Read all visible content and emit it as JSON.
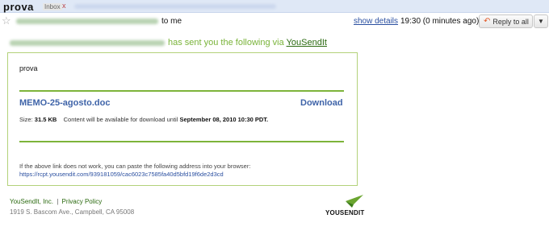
{
  "header": {
    "subject": "prova",
    "label": "Inbox",
    "label_remove": "x"
  },
  "sender_row": {
    "to_text": "to me",
    "show_details": "show details",
    "time": "19:30 (0 minutes ago)",
    "reply_button": "Reply to all",
    "more_button": "▼"
  },
  "intro": {
    "text": "has sent you the following via ",
    "link": "YouSendIt"
  },
  "card": {
    "message": "prova",
    "file_name": "MEMO-25-agosto.doc",
    "download": "Download",
    "size_label": "Size:",
    "size_value": "31.5 KB",
    "availability_text": "Content will be available for download until",
    "availability_date": "September 08, 2010 10:30 PDT.",
    "fallback_text": "If the above link does not work, you can paste the following address into your browser:",
    "fallback_url": "https://rcpt.yousendit.com/939181059/cac6023c7585fa40d5bfd19f6de2d3cd"
  },
  "footer": {
    "company": "YouSendIt, Inc.",
    "separator": "|",
    "privacy": "Privacy Policy",
    "address": "1919 S. Bascom Ave., Campbell, CA 95008",
    "logo_text": "YOUSENDIT"
  },
  "colors": {
    "accent_green": "#7db43a",
    "link_blue": "#3e63a8",
    "header_bg": "#dfe8f6"
  },
  "icons": {
    "star": "star-icon",
    "reply": "reply-arrow-icon",
    "logo": "yousendit-logo-icon"
  }
}
